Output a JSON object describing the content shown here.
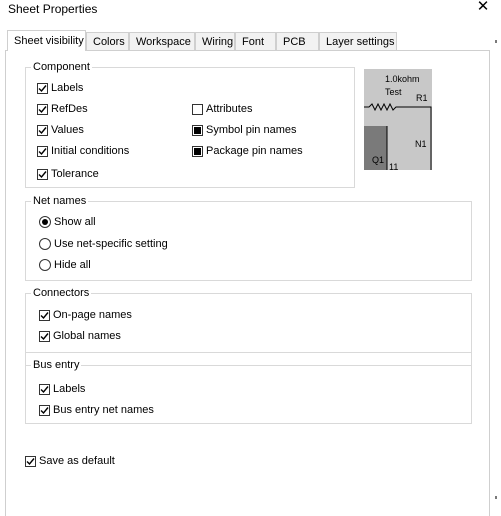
{
  "window": {
    "title": "Sheet Properties",
    "close_glyph": "✕"
  },
  "tabs": [
    {
      "label": "Sheet visibility",
      "active": true
    },
    {
      "label": "Colors"
    },
    {
      "label": "Workspace"
    },
    {
      "label": "Wiring"
    },
    {
      "label": "Font"
    },
    {
      "label": "PCB"
    },
    {
      "label": "Layer settings"
    }
  ],
  "component": {
    "legend": "Component",
    "labels": {
      "label": "Labels",
      "checked": true
    },
    "refdes": {
      "label": "RefDes",
      "checked": true
    },
    "values": {
      "label": "Values",
      "checked": true
    },
    "initial_conditions": {
      "label": "Initial conditions",
      "checked": true
    },
    "tolerance": {
      "label": "Tolerance",
      "checked": true
    },
    "attributes": {
      "label": "Attributes",
      "checked": false
    },
    "symbol_pin_names": {
      "label": "Symbol pin names",
      "state": "indeterminate"
    },
    "package_pin_names": {
      "label": "Package pin names",
      "state": "indeterminate"
    }
  },
  "preview": {
    "value_text": "1.0kohm",
    "test_text": "Test",
    "r_label": "R1",
    "n_label": "N1",
    "q_label": "Q1",
    "pin_label": "11"
  },
  "net_names": {
    "legend": "Net names",
    "options": [
      {
        "label": "Show all",
        "selected": true
      },
      {
        "label": "Use net-specific setting",
        "selected": false
      },
      {
        "label": "Hide all",
        "selected": false
      }
    ]
  },
  "connectors": {
    "legend": "Connectors",
    "on_page_names": {
      "label": "On-page names",
      "checked": true
    },
    "global_names": {
      "label": "Global names",
      "checked": true
    }
  },
  "bus_entry": {
    "legend": "Bus entry",
    "labels": {
      "label": "Labels",
      "checked": true
    },
    "bus_entry_net_names": {
      "label": "Bus entry net names",
      "checked": true
    }
  },
  "save_as_default": {
    "label": "Save as default",
    "checked": true
  }
}
